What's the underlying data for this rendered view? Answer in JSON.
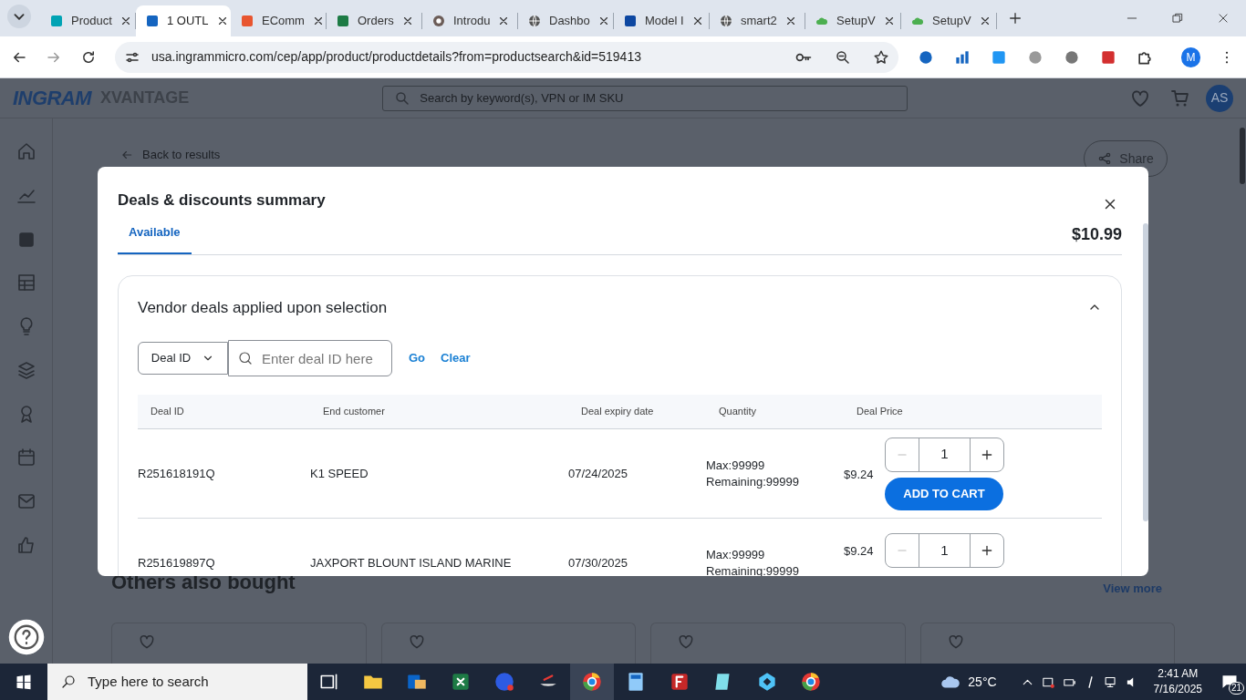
{
  "browser": {
    "tabs": [
      {
        "title": "Product",
        "selected": false
      },
      {
        "title": "1 OUTL",
        "selected": true
      },
      {
        "title": "EComm",
        "selected": false
      },
      {
        "title": "Orders",
        "selected": false
      },
      {
        "title": "Introdu",
        "selected": false
      },
      {
        "title": "Dashbo",
        "selected": false
      },
      {
        "title": "Model I",
        "selected": false
      },
      {
        "title": "smart2",
        "selected": false
      },
      {
        "title": "SetupV",
        "selected": false
      },
      {
        "title": "SetupV",
        "selected": false
      }
    ],
    "address": "usa.ingrammicro.com/cep/app/product/productdetails?from=productsearch&id=519413",
    "profile": "M"
  },
  "header": {
    "logo": "INGRAM",
    "brand": "XVANTAGE",
    "search_placeholder": "Search by keyword(s), VPN or IM SKU",
    "avatar": "AS"
  },
  "page": {
    "back_link": "Back to results",
    "share": "Share",
    "section_title": "Others also bought",
    "view_more": "View more"
  },
  "modal": {
    "title": "Deals & discounts summary",
    "tabs": [
      {
        "label": "Available",
        "selected": true
      }
    ],
    "total": "$10.99",
    "panel": {
      "title": "Vendor deals applied upon selection",
      "expanded": true,
      "filter": {
        "select": "Deal ID",
        "placeholder": "Enter deal ID here",
        "go": "Go",
        "clear": "Clear"
      },
      "columns": [
        "Deal ID",
        "End customer",
        "Deal expiry date",
        "Quantity",
        "Deal Price"
      ],
      "rows": [
        {
          "deal_id": "R251618191Q",
          "end_customer": "K1 SPEED",
          "expiry": "07/24/2025",
          "max": "Max:99999",
          "remaining": "Remaining:99999",
          "price": "$9.24",
          "quantity": "1",
          "action": "ADD TO CART"
        },
        {
          "deal_id": "R251619897Q",
          "end_customer": "JAXPORT BLOUNT ISLAND MARINE",
          "expiry": "07/30/2025",
          "max": "Max:99999",
          "remaining": "Remaining:99999",
          "price": "$9.24",
          "quantity": "1"
        }
      ]
    }
  },
  "taskbar": {
    "search_placeholder": "Type here to search",
    "temperature": "25°C",
    "time": "2:41 AM",
    "date": "7/16/2025",
    "notifications": "21"
  }
}
